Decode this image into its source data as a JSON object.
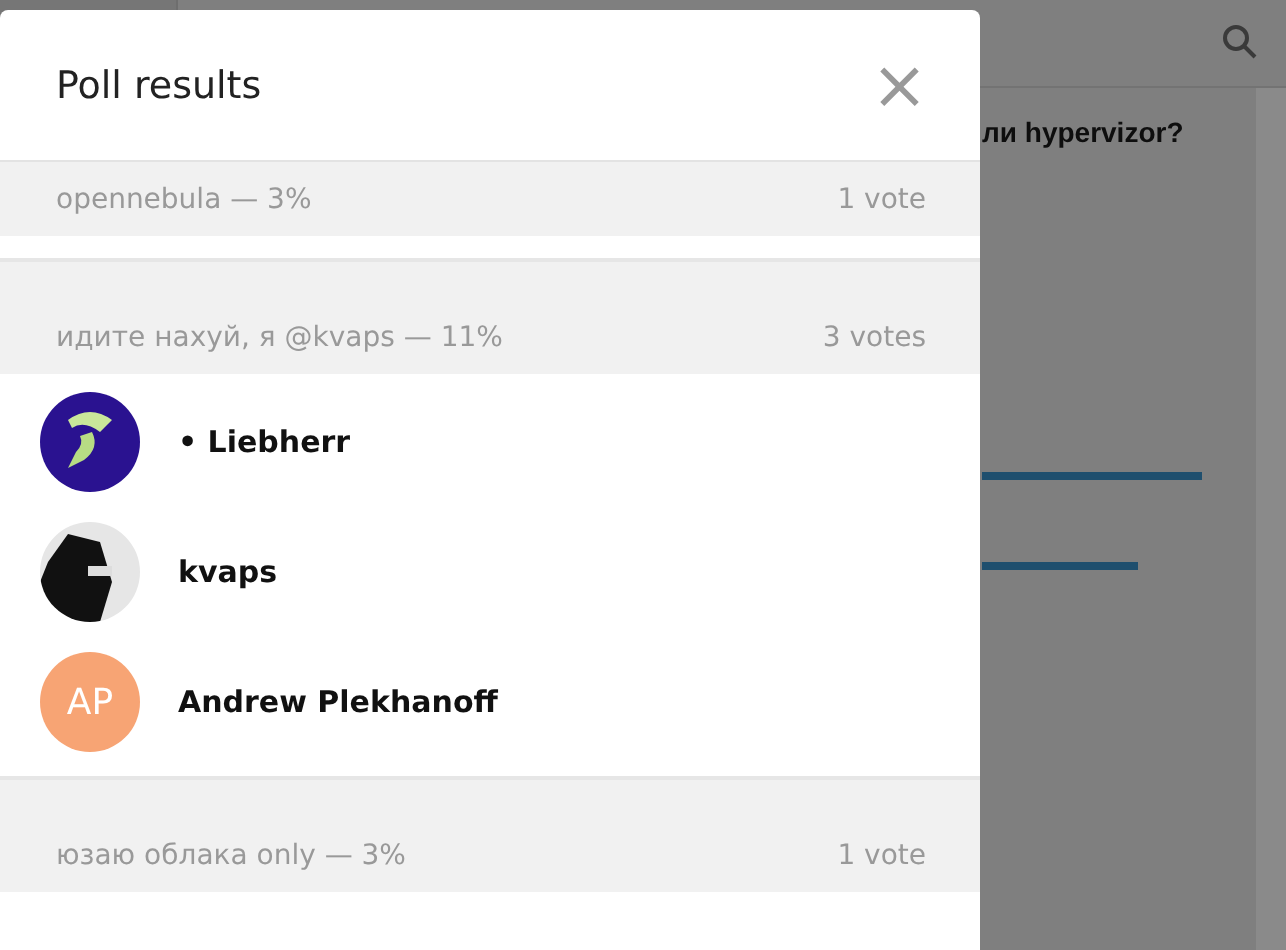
{
  "background": {
    "question_fragment": "ли hypervizor?"
  },
  "dialog": {
    "title": "Poll results",
    "close_icon": "×"
  },
  "options": [
    {
      "text": "opennebula — 3%",
      "votes": "1 vote"
    },
    {
      "text": "идите нахуй, я @kvaps — 11%",
      "votes": "3 votes",
      "voters": [
        {
          "name": "• Liebherr"
        },
        {
          "name": "kvaps"
        },
        {
          "name": "Andrew Plekhanoff",
          "avatar": {
            "kind": "initials",
            "initials": "AP",
            "color": "#f7a474"
          }
        }
      ]
    },
    {
      "text": "юзаю облака only — 3%",
      "votes": "1 vote"
    }
  ]
}
